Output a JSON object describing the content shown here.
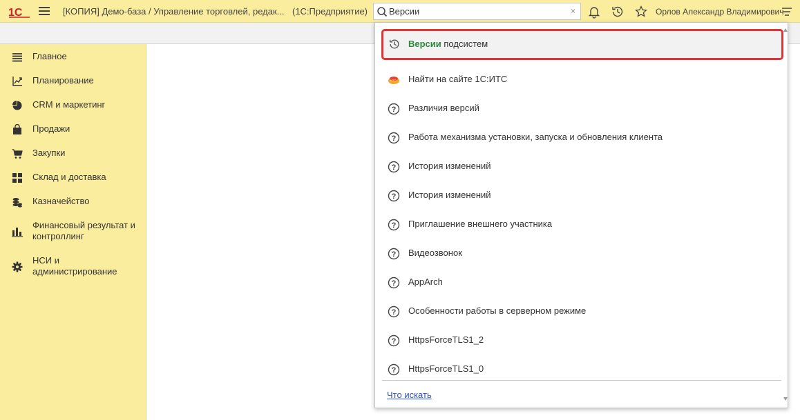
{
  "topbar": {
    "title": "[КОПИЯ] Демо-база / Управление торговлей, редак...",
    "mode": "(1С:Предприятие)",
    "search_value": "Версии",
    "clear_glyph": "×",
    "user": "Орлов Александр Владимирович",
    "icons": [
      "bell-icon",
      "history-icon",
      "star-icon",
      "menu-filter-icon"
    ]
  },
  "sidebar": {
    "items": [
      {
        "label": "Главное",
        "icon": "list-icon"
      },
      {
        "label": "Планирование",
        "icon": "planning-icon"
      },
      {
        "label": "CRM и маркетинг",
        "icon": "pie-icon"
      },
      {
        "label": "Продажи",
        "icon": "bag-icon"
      },
      {
        "label": "Закупки",
        "icon": "cart-icon"
      },
      {
        "label": "Склад и доставка",
        "icon": "grid-icon"
      },
      {
        "label": "Казначейство",
        "icon": "coins-icon"
      },
      {
        "label": "Финансовый результат и контроллинг",
        "icon": "bars-icon"
      },
      {
        "label": "НСИ и администрирование",
        "icon": "gear-icon"
      }
    ]
  },
  "dropdown": {
    "first_bold": "Версии",
    "first_rest": " подсистем",
    "items": [
      {
        "label": "Найти на сайте 1С:ИТС",
        "icon": "its-icon"
      },
      {
        "label": "Различия версий",
        "icon": "help-icon"
      },
      {
        "label": "Работа механизма установки, запуска и обновления клиента",
        "icon": "help-icon"
      },
      {
        "label": "История изменений",
        "icon": "help-icon"
      },
      {
        "label": "История изменений",
        "icon": "help-icon"
      },
      {
        "label": "Приглашение внешнего участника",
        "icon": "help-icon"
      },
      {
        "label": "Видеозвонок",
        "icon": "help-icon"
      },
      {
        "label": "AppArch",
        "icon": "help-icon"
      },
      {
        "label": "Особенности работы в серверном режиме",
        "icon": "help-icon"
      },
      {
        "label": "HttpsForceTLS1_2",
        "icon": "help-icon"
      },
      {
        "label": "HttpsForceTLS1_0",
        "icon": "help-icon"
      }
    ],
    "footer_link": "Что искать"
  },
  "colors": {
    "topbar_bg": "#fbed9e",
    "highlight_border": "#e03535",
    "match_green": "#2a8a3a",
    "link_blue": "#2b55b6"
  }
}
